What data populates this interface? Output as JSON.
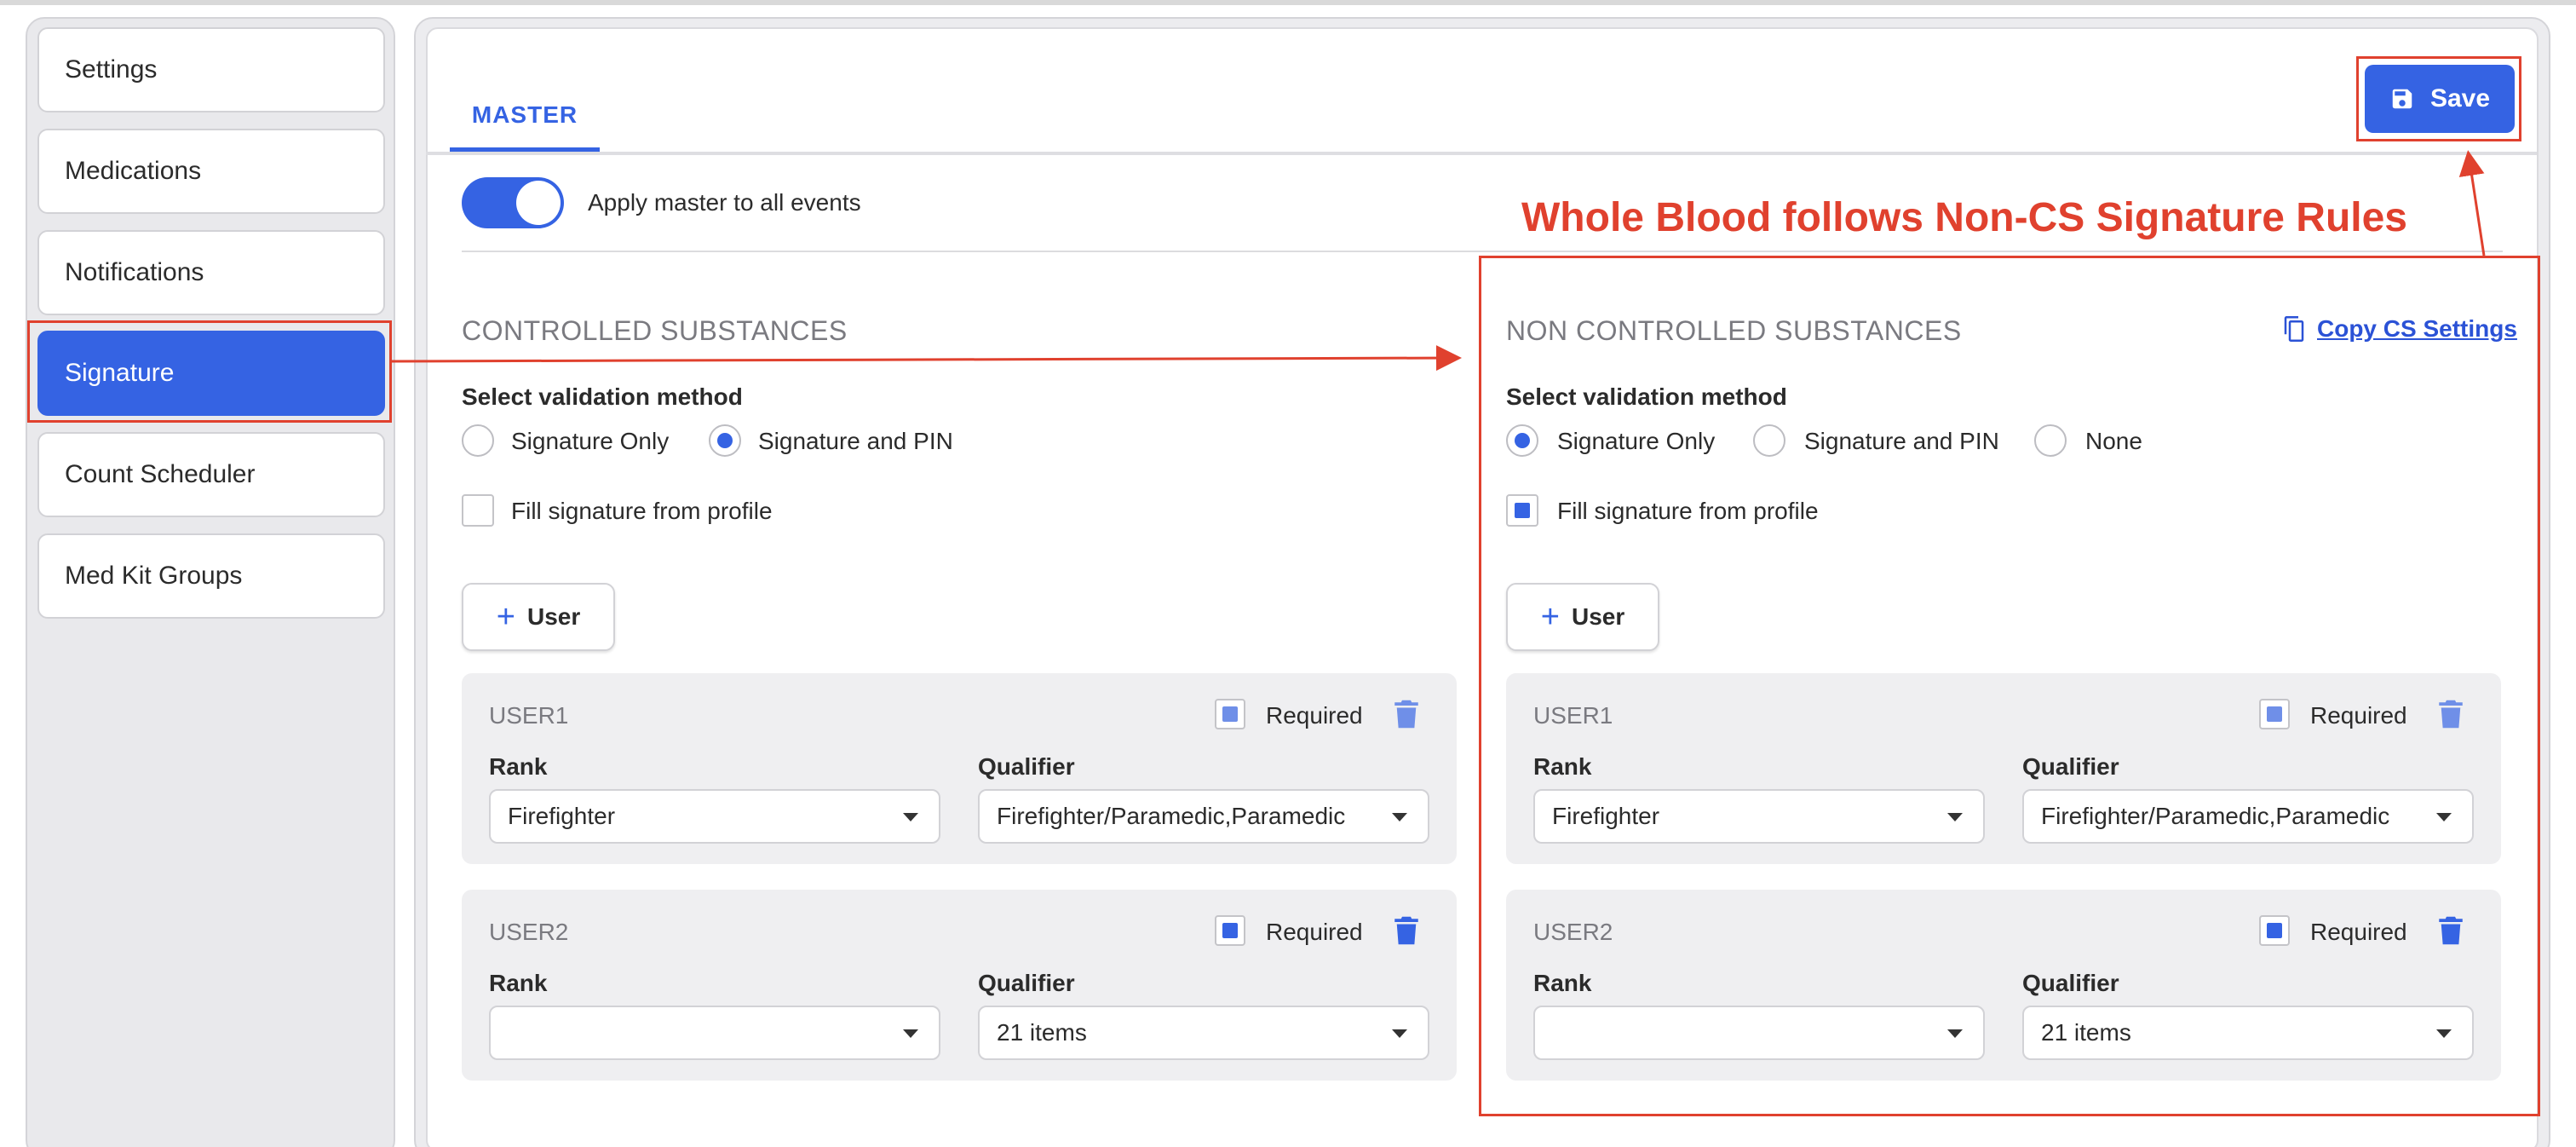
{
  "sidebar": {
    "items": [
      {
        "label": "Settings"
      },
      {
        "label": "Medications"
      },
      {
        "label": "Notifications"
      },
      {
        "label": "Signature"
      },
      {
        "label": "Count Scheduler"
      },
      {
        "label": "Med Kit Groups"
      }
    ],
    "active": "Signature"
  },
  "header": {
    "tab_label": "MASTER",
    "save_label": "Save"
  },
  "toggle": {
    "label": "Apply master to all events",
    "on": true
  },
  "annotation": {
    "title": "Whole Blood follows Non-CS Signature Rules",
    "color": "#e0412e"
  },
  "controlled": {
    "title": "CONTROLLED SUBSTANCES",
    "validation_label": "Select validation method",
    "options": [
      "Signature Only",
      "Signature and PIN"
    ],
    "selected": "Signature and PIN",
    "fill_label": "Fill signature from profile",
    "fill_checked": false,
    "add_user_label": "User",
    "users": [
      {
        "name": "USER1",
        "required_label": "Required",
        "required": true,
        "rank_label": "Rank",
        "rank": "Firefighter",
        "qualifier_label": "Qualifier",
        "qualifier": "Firefighter/Paramedic,Paramedic"
      },
      {
        "name": "USER2",
        "required_label": "Required",
        "required": true,
        "rank_label": "Rank",
        "rank": "",
        "qualifier_label": "Qualifier",
        "qualifier": "21 items"
      }
    ]
  },
  "noncontrolled": {
    "title": "NON CONTROLLED SUBSTANCES",
    "copy_label": "Copy CS Settings",
    "validation_label": "Select validation method",
    "options": [
      "Signature Only",
      "Signature and PIN",
      "None"
    ],
    "selected": "Signature Only",
    "fill_label": "Fill signature from profile",
    "fill_checked": true,
    "add_user_label": "User",
    "users": [
      {
        "name": "USER1",
        "required_label": "Required",
        "required": true,
        "rank_label": "Rank",
        "rank": "Firefighter",
        "qualifier_label": "Qualifier",
        "qualifier": "Firefighter/Paramedic,Paramedic"
      },
      {
        "name": "USER2",
        "required_label": "Required",
        "required": true,
        "rank_label": "Rank",
        "rank": "",
        "qualifier_label": "Qualifier",
        "qualifier": "21 items"
      }
    ]
  },
  "colors": {
    "accent": "#3563e3",
    "annotation": "#e0412e"
  }
}
